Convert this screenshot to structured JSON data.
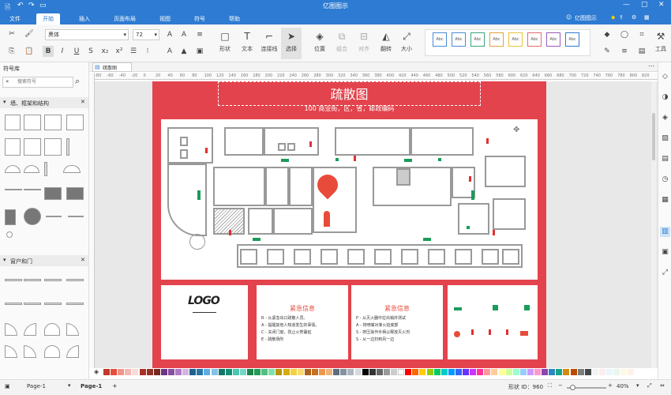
{
  "app": {
    "title": "亿图图示",
    "file_menu": "文件",
    "user_label": "亿图图示"
  },
  "tabs": [
    "开始",
    "插入",
    "页面布局",
    "视图",
    "符号",
    "帮助"
  ],
  "toolbar": {
    "font_name": "黑体",
    "font_size": "72",
    "shape_label": "形状",
    "text_label": "文本",
    "connector_label": "连接线",
    "select_label": "选择",
    "position_label": "位置",
    "group_label": "组合",
    "align_label": "对齐",
    "flip_label": "翻转",
    "size_label": "大小",
    "tools_label": "工具",
    "style_sample": "Abc"
  },
  "sidebar": {
    "title": "符号库",
    "search_placeholder": "搜索符号",
    "cat1": "墙、框架和结构",
    "cat2": "窗户和门"
  },
  "doc_tab": "疏散图",
  "ruler": [
    "-80",
    "-60",
    "-40",
    "-20",
    "0",
    "20",
    "40",
    "60",
    "80",
    "100",
    "120",
    "140",
    "160",
    "180",
    "200",
    "220",
    "240",
    "260",
    "280",
    "300",
    "320",
    "340",
    "360",
    "380",
    "400",
    "420",
    "440",
    "460",
    "480",
    "500",
    "520",
    "540",
    "560",
    "580",
    "600",
    "620",
    "640",
    "660",
    "680",
    "700",
    "720",
    "740",
    "760",
    "780",
    "800",
    "820"
  ],
  "poster": {
    "title": "疏散图",
    "subtitle": "100 商业街，区，省，邮政编码",
    "logo": "LOGO",
    "emergency1_title": "紧急信息",
    "emergency1_lines": [
      "R - 从紧急出口疏散人员。",
      "A - 提醒其他人知道发生的事情。",
      "C - 关闭门窗，防止火势蔓延",
      "E - 疏散场所"
    ],
    "emergency2_title": "紧急信息",
    "emergency2_lines": [
      "P - 从灭火器中拉出销并测试",
      "A - 将喷嘴对准火焰底部",
      "S - 挤压操作手柄以释放灭火剂",
      "S - 从一边扫到另一边"
    ]
  },
  "colors": [
    "#c0392b",
    "#e74c3c",
    "#f1948a",
    "#f5b7b1",
    "#fadbd8",
    "#a93226",
    "#943126",
    "#78281f",
    "#6c3483",
    "#884ea0",
    "#af7ac5",
    "#d2b4de",
    "#1f618d",
    "#2874a6",
    "#5dade2",
    "#85c1e9",
    "#117864",
    "#148f77",
    "#48c9b0",
    "#76d7c4",
    "#1d8348",
    "#239b56",
    "#52be80",
    "#82e0aa",
    "#b7950b",
    "#d4ac0d",
    "#f4d03f",
    "#f7dc6f",
    "#af601a",
    "#ca6f1e",
    "#eb984e",
    "#f0b27a",
    "#5d6d7e",
    "#85929e",
    "#aeb6bf",
    "#d5dbdb",
    "#000000",
    "#333333",
    "#666666",
    "#999999",
    "#cccccc",
    "#ffffff",
    "#ff0000",
    "#ff6600",
    "#ffcc00",
    "#99cc00",
    "#00cc66",
    "#00cccc",
    "#0099ff",
    "#3366ff",
    "#6633ff",
    "#cc33ff",
    "#ff3399",
    "#ff9999",
    "#ffcc99",
    "#ffff99",
    "#ccff99",
    "#99ffcc",
    "#99ccff",
    "#cc99ff",
    "#ff99cc",
    "#8e44ad",
    "#2e86c1",
    "#17a589",
    "#d68910",
    "#ba4a00",
    "#7b7d7d",
    "#424949",
    "#f2f3f4",
    "#fdedec",
    "#ebf5fb",
    "#e9f7ef",
    "#fef9e7",
    "#fdf2e9"
  ],
  "status": {
    "page_tab": "Page-1",
    "page_current": "Page-1",
    "shape_id": "形状 ID：960",
    "zoom": "40%"
  }
}
